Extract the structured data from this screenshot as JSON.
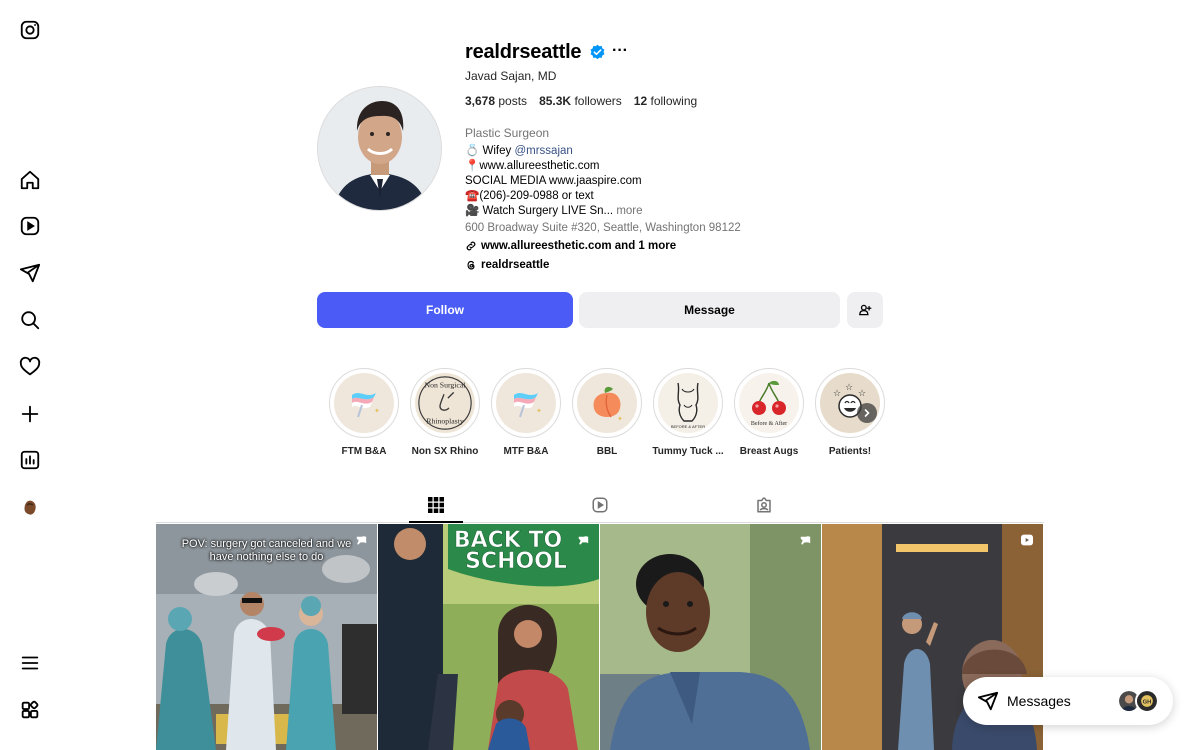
{
  "profile": {
    "username": "realdrseattle",
    "full_name": "Javad Sajan, MD",
    "posts_count": "3,678",
    "posts_label": "posts",
    "followers_count": "85.3K",
    "followers_label": "followers",
    "following_count": "12",
    "following_label": "following",
    "category": "Plastic Surgeon",
    "bio": {
      "line1_prefix": "💍 Wifey",
      "line1_mention": "@mrssajan",
      "line2": "📍www.allureesthetic.com",
      "line3": "SOCIAL MEDIA www.jaaspire.com",
      "line4": "☎️(206)-209-0988 or text",
      "line5": "🎥 Watch Surgery LIVE Sn...",
      "more_label": "more"
    },
    "address": "600 Broadway Suite #320, Seattle, Washington 98122",
    "external_link": "www.allureesthetic.com and 1 more",
    "threads_handle": "realdrseattle"
  },
  "actions": {
    "follow_label": "Follow",
    "message_label": "Message"
  },
  "highlights": [
    {
      "label": "FTM B&A",
      "icon": "flag-icon"
    },
    {
      "label": "Non SX Rhino",
      "icon": "nose-icon",
      "art_line1": "Non Surgical",
      "art_line2": "Rhinoplasty"
    },
    {
      "label": "MTF B&A",
      "icon": "flag-icon"
    },
    {
      "label": "BBL",
      "icon": "peach-icon"
    },
    {
      "label": "Tummy Tuck ...",
      "icon": "torso-icon",
      "art_text": "BEFORE & AFTER"
    },
    {
      "label": "Breast Augs",
      "icon": "cherries-icon",
      "art_text": "Before & After"
    },
    {
      "label": "Patients!",
      "icon": "smiley-stars-icon"
    }
  ],
  "posts": [
    {
      "caption": "POV: surgery got canceled and we have nothing else to do",
      "pinned": true
    },
    {
      "caption": "BACK TO SCHOOL",
      "pinned": true
    },
    {
      "caption": "",
      "pinned": true
    },
    {
      "caption": "",
      "pinned": false,
      "is_reel": true
    }
  ],
  "messages": {
    "label": "Messages"
  },
  "colors": {
    "follow_button": "#4a5cf5",
    "verified_badge": "#0095f6",
    "link": "#385185"
  }
}
